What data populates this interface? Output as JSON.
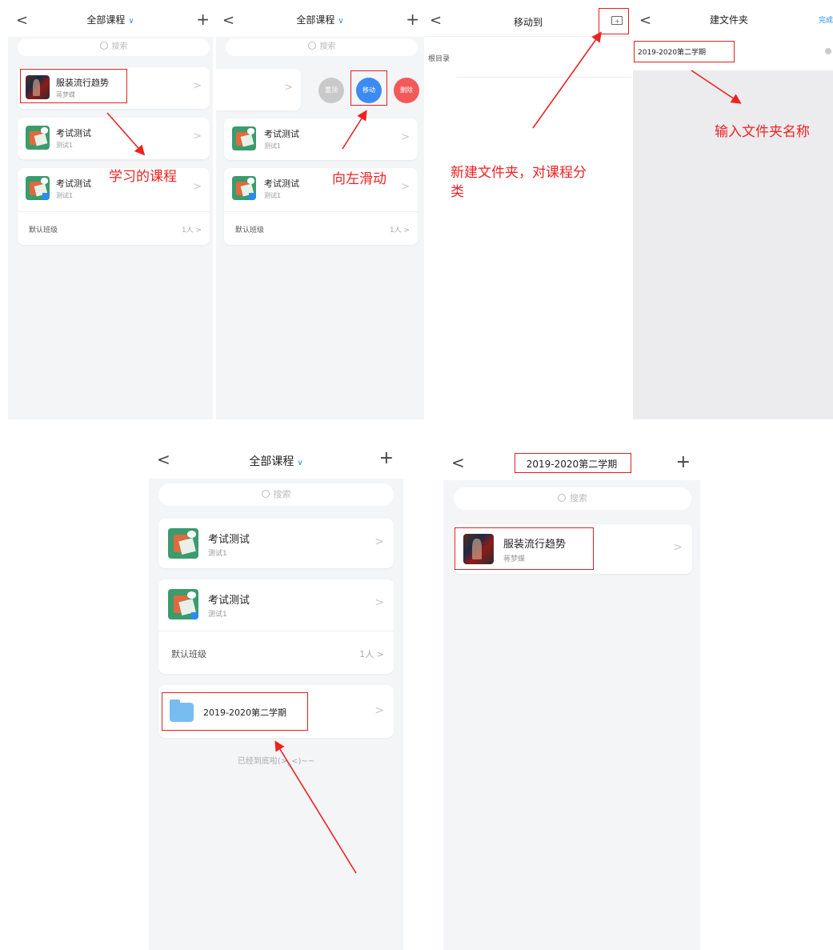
{
  "colors": {
    "accent": "#2b8cf0",
    "annotation": "#e02020",
    "top_btn": "#c9c9c9",
    "move_btn": "#3d8bf2",
    "delete_btn": "#f25a5a",
    "folder": "#78bdf0"
  },
  "icons": {
    "back": "chevron-left-icon",
    "add": "plus-icon",
    "search": "search-icon",
    "dropdown": "chevron-down-icon",
    "new_folder": "new-folder-icon",
    "clear": "clear-icon",
    "folder": "folder-icon"
  },
  "common": {
    "back": "<",
    "plus": "+",
    "chevron": ">",
    "dropdown": "∨",
    "all_courses": "全部课程",
    "search_placeholder": "搜索",
    "course_fashion": {
      "name": "服装流行趋势",
      "teacher": "蒋梦蝶"
    },
    "course_exam": {
      "name": "考试测试",
      "teacher": "测试1"
    },
    "default_class": "默认班级",
    "class_count": "1人 >",
    "folder_name": "2019-2020第二学期"
  },
  "screen3": {
    "title": "移动到",
    "root": "根目录",
    "note": "新建文件夹，对课程分类"
  },
  "screen4": {
    "title": "建文件夹",
    "done": "完成",
    "input_value": "2019-2020第二学期",
    "note": "输入文件夹名称"
  },
  "screen1": {
    "note": "学习的课程"
  },
  "screen2": {
    "note": "向左滑动",
    "actions": {
      "top": "置顶",
      "move": "移动",
      "delete": "删除"
    }
  },
  "screen5": {
    "end_text": "已经到底啦(>_<)~~"
  }
}
